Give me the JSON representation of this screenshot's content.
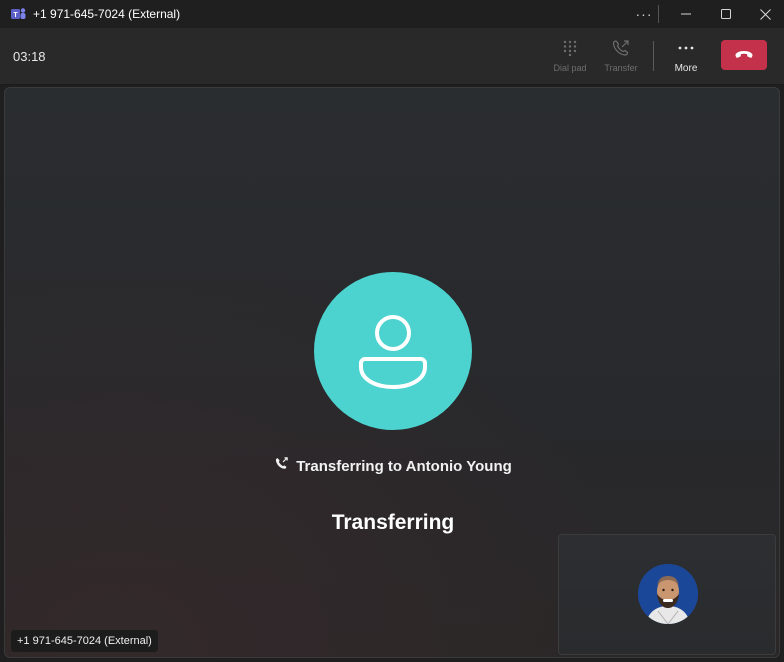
{
  "window": {
    "title": "+1 971-645-7024 (External)",
    "more_glyph": "···",
    "app_icon": "teams-icon"
  },
  "toolbar": {
    "timer": "03:18",
    "dialpad_label": "Dial pad",
    "transfer_label": "Transfer",
    "more_label": "More",
    "more_glyph": "···",
    "hangup_icon": "phone-hangup-icon"
  },
  "stage": {
    "transfer_text": "Transferring to Antonio Young",
    "status": "Transferring",
    "caller_tag": "+1 971-645-7024 (External)"
  },
  "colors": {
    "avatar_bg": "#4cd3cf",
    "hangup_bg": "#c4314b",
    "app_accent": "#5b5fc7"
  }
}
